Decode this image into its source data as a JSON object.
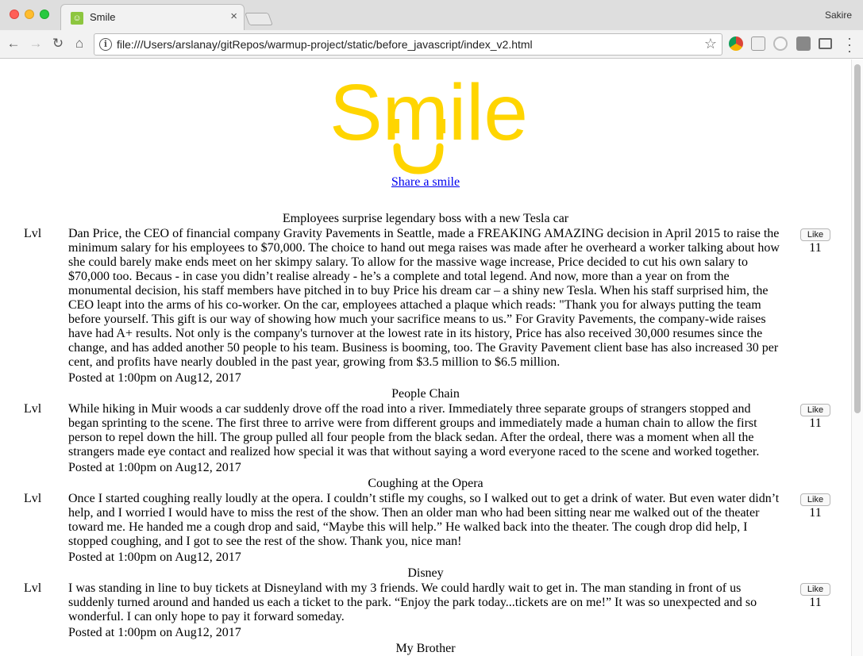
{
  "browser": {
    "tab_title": "Smile",
    "tab_close": "×",
    "profile_name": "Sakire",
    "url": "file:///Users/arslanay/gitRepos/warmup-project/static/before_javascript/index_v2.html",
    "icons": [
      "back-arrow-icon",
      "forward-arrow-icon",
      "reload-icon",
      "home-icon",
      "info-icon",
      "star-icon",
      "menu-icon"
    ],
    "colors": {
      "logo": "#ffd500",
      "link": "#0000ee"
    }
  },
  "page": {
    "logo_text": "Smile",
    "share_link": "Share a smile",
    "stories": [
      {
        "title": "Employees surprise legendary boss with a new Tesla car",
        "lvl": "Lvl",
        "body": "Dan Price, the CEO of financial company Gravity Pavements in Seattle, made a FREAKING AMAZING decision in April 2015 to raise the minimum salary for his employees to $70,000. The choice to hand out mega raises was made after he overheard a worker talking about how she could barely make ends meet on her skimpy salary. To allow for the massive wage increase, Price decided to cut his own salary to $70,000 too. Becaus - in case you didn’t realise already - he’s a complete and total legend. And now, more than a year on from the monumental decision, his staff members have pitched in to buy Price his dream car – a shiny new Tesla. When his staff surprised him, the CEO leapt into the arms of his co-worker. On the car, employees attached a plaque which reads: \"Thank you for always putting the team before yourself. This gift is our way of showing how much your sacrifice means to us.” For Gravity Pavements, the company-wide raises have had A+ results. Not only is the company's turnover at the lowest rate in its history, Price has also received 30,000 resumes since the change, and has added another 50 people to his team. Business is booming, too. The Gravity Pavement client base has also increased 30 per cent, and profits have nearly doubled in the past year, growing from $3.5 million to $6.5 million.",
        "posted": "Posted at 1:00pm on Aug12, 2017",
        "like_label": "Like",
        "like_count": "11"
      },
      {
        "title": "People Chain",
        "lvl": "Lvl",
        "body": "While hiking in Muir woods a car suddenly drove off the road into a river. Immediately three separate groups of strangers stopped and began sprinting to the scene. The first three to arrive were from different groups and immediately made a human chain to allow the first person to repel down the hill. The group pulled all four people from the black sedan. After the ordeal, there was a moment when all the strangers made eye contact and realized how special it was that without saying a word everyone raced to the scene and worked together.",
        "posted": "Posted at 1:00pm on Aug12, 2017",
        "like_label": "Like",
        "like_count": "11"
      },
      {
        "title": "Coughing at the Opera",
        "lvl": "Lvl",
        "body": "Once I started coughing really loudly at the opera. I couldn’t stifle my coughs, so I walked out to get a drink of water. But even water didn’t help, and I worried I would have to miss the rest of the show. Then an older man who had been sitting near me walked out of the theater toward me. He handed me a cough drop and said, “Maybe this will help.” He walked back into the theater. The cough drop did help, I stopped coughing, and I got to see the rest of the show. Thank you, nice man!",
        "posted": "Posted at 1:00pm on Aug12, 2017",
        "like_label": "Like",
        "like_count": "11"
      },
      {
        "title": "Disney",
        "lvl": "Lvl",
        "body": "I was standing in line to buy tickets at Disneyland with my 3 friends. We could hardly wait to get in. The man standing in front of us suddenly turned around and handed us each a ticket to the park. “Enjoy the park today...tickets are on me!” It was so unexpected and so wonderful. I can only hope to pay it forward someday.",
        "posted": "Posted at 1:00pm on Aug12, 2017",
        "like_label": "Like",
        "like_count": "11"
      }
    ],
    "partial_title": "My Brother"
  }
}
